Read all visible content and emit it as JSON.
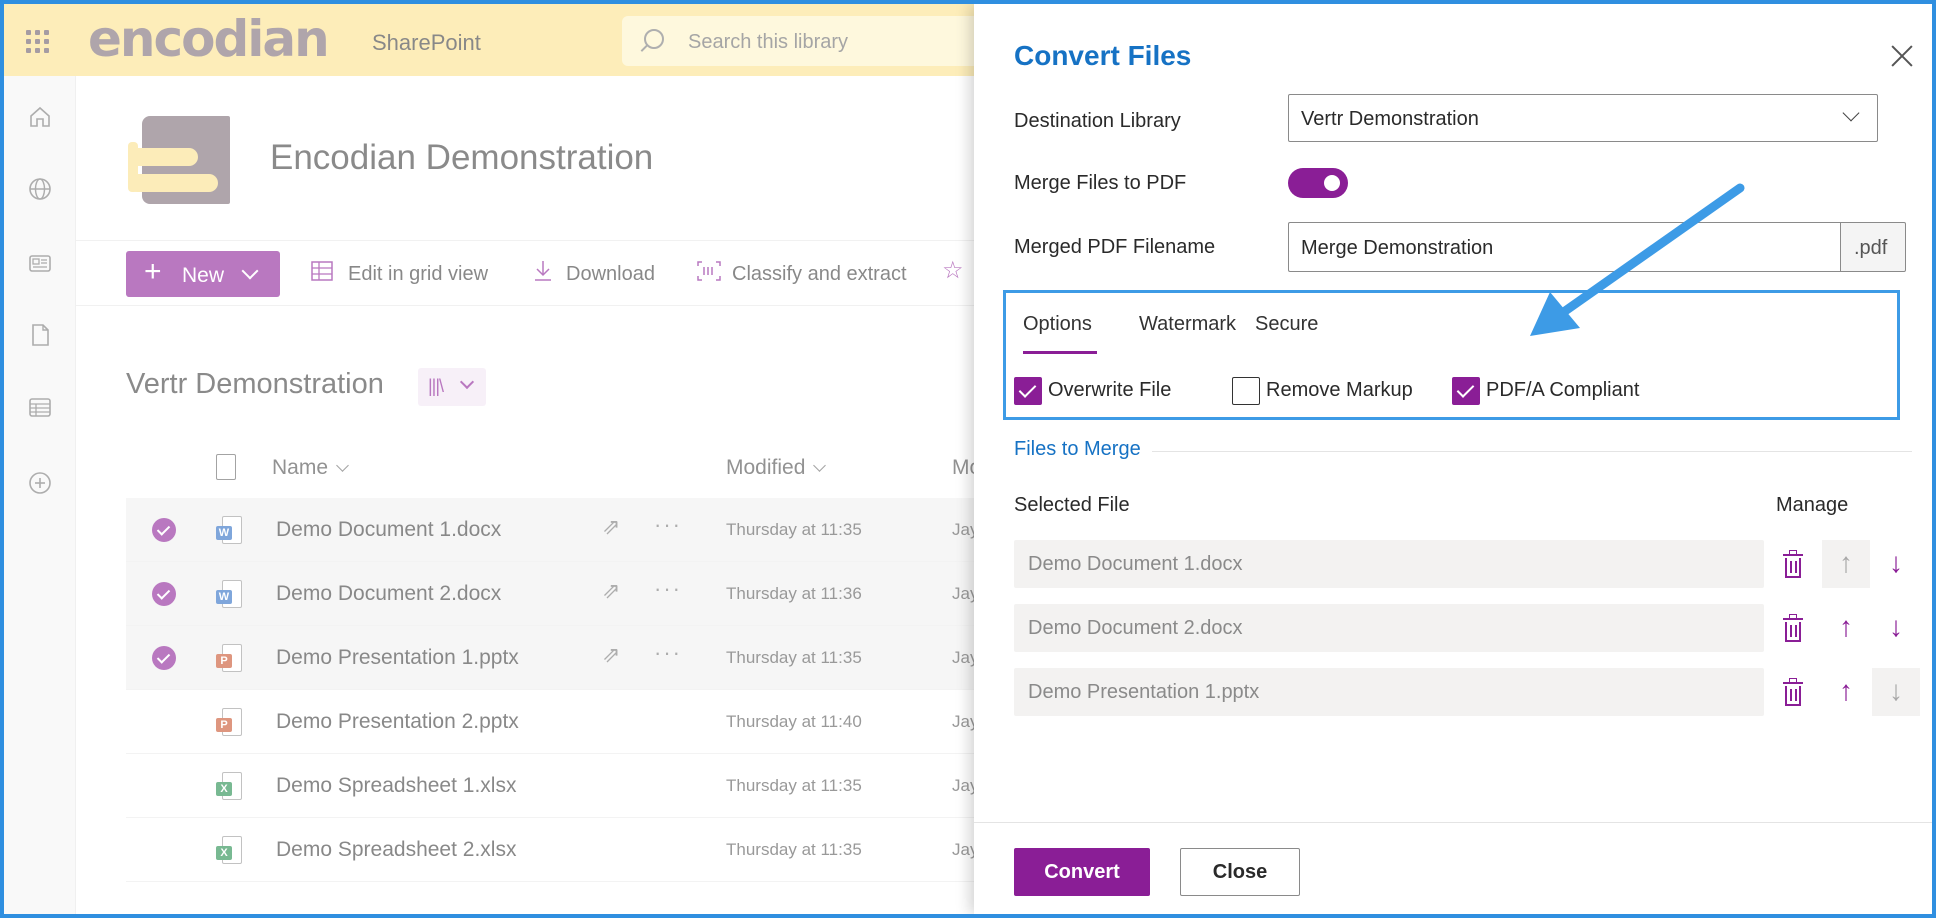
{
  "topbar": {
    "logo": "encodian",
    "app_name": "SharePoint",
    "search_placeholder": "Search this library"
  },
  "rail": {
    "icons": [
      "home-icon",
      "globe-icon",
      "news-icon",
      "document-icon",
      "list-icon",
      "add-icon"
    ]
  },
  "site": {
    "title": "Encodian Demonstration"
  },
  "commandbar": {
    "new_label": "New",
    "edit_grid": "Edit in grid view",
    "download": "Download",
    "classify": "Classify and extract"
  },
  "library": {
    "title": "Vertr Demonstration",
    "columns": {
      "name": "Name",
      "modified": "Modified",
      "modified_by": "Mo"
    },
    "rows": [
      {
        "name": "Demo Document 1.docx",
        "modified": "Thursday at 11:35",
        "by": "Jay",
        "type": "word",
        "selected": true
      },
      {
        "name": "Demo Document 2.docx",
        "modified": "Thursday at 11:36",
        "by": "Jay",
        "type": "word",
        "selected": true
      },
      {
        "name": "Demo Presentation 1.pptx",
        "modified": "Thursday at 11:35",
        "by": "Jay",
        "type": "ppt",
        "selected": true
      },
      {
        "name": "Demo Presentation 2.pptx",
        "modified": "Thursday at 11:40",
        "by": "Jay",
        "type": "ppt",
        "selected": false
      },
      {
        "name": "Demo Spreadsheet 1.xlsx",
        "modified": "Thursday at 11:35",
        "by": "Jay",
        "type": "excel",
        "selected": false
      },
      {
        "name": "Demo Spreadsheet 2.xlsx",
        "modified": "Thursday at 11:35",
        "by": "Jay",
        "type": "excel",
        "selected": false
      }
    ]
  },
  "panel": {
    "title": "Convert Files",
    "destination_label": "Destination Library",
    "destination_value": "Vertr Demonstration",
    "merge_label": "Merge Files to PDF",
    "merge_on": true,
    "filename_label": "Merged PDF Filename",
    "filename_value": "Merge Demonstration",
    "filename_suffix": ".pdf",
    "tabs": [
      "Options",
      "Watermark",
      "Secure"
    ],
    "active_tab": "Options",
    "options": [
      {
        "label": "Overwrite File",
        "checked": true
      },
      {
        "label": "Remove Markup",
        "checked": false
      },
      {
        "label": "PDF/A Compliant",
        "checked": true
      }
    ],
    "files_section": "Files to Merge",
    "selected_file_header": "Selected File",
    "manage_header": "Manage",
    "files": [
      "Demo Document 1.docx",
      "Demo Document 2.docx",
      "Demo Presentation 1.pptx"
    ],
    "convert_label": "Convert",
    "close_label": "Close"
  },
  "colors": {
    "accent": "#8a1e96",
    "link": "#1672c4",
    "topbar": "#fce28a",
    "annotation": "#3d9be6"
  }
}
